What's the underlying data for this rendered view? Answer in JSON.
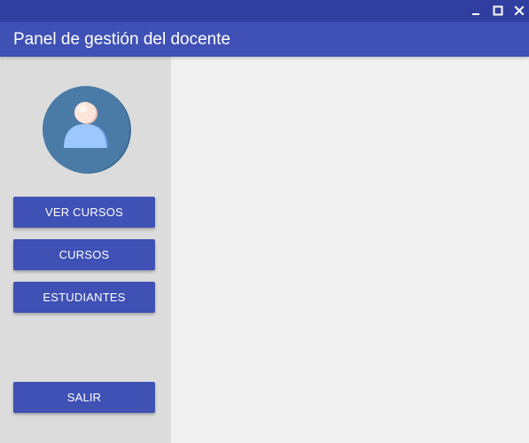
{
  "window": {
    "controls": [
      "minimize-icon",
      "maximize-icon",
      "close-icon"
    ]
  },
  "header": {
    "title": "Panel de gestión del docente"
  },
  "sidebar": {
    "avatar_icon": "user-avatar-icon",
    "buttons": {
      "ver_cursos": "VER CURSOS",
      "cursos": "CURSOS",
      "estudiantes": "ESTUDIANTES",
      "salir": "SALIR"
    }
  },
  "colors": {
    "titlebar": "#303f9f",
    "header": "#3f51b5",
    "button": "#3f51b5",
    "sidebar": "#dcdcdc",
    "content": "#f0f0f0",
    "avatar_circle": "#4a7ba7"
  }
}
